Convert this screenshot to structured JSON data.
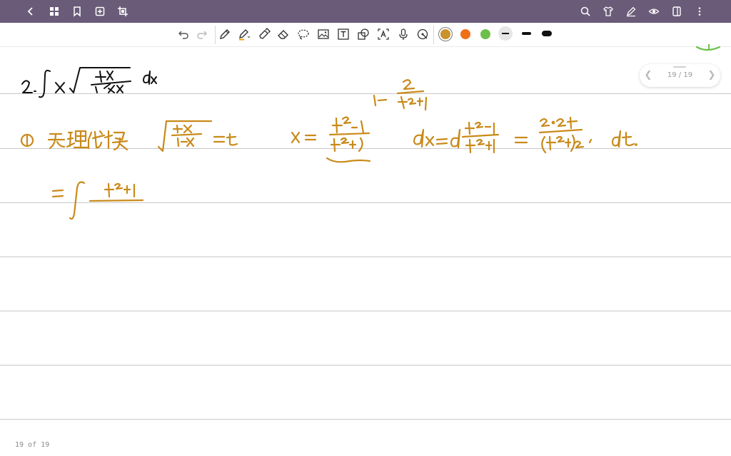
{
  "colors": {
    "topbar": "#6a5b78",
    "ink_black": "#111111",
    "ink_orange": "#c98a1a",
    "swatch_gold": "#c9922a",
    "swatch_orange": "#f07018",
    "swatch_green": "#6cc04a",
    "rule_line": "#c8c8c8"
  },
  "topbar": {
    "left_icons": [
      "back-chevron-icon",
      "grid-icon",
      "bookmark-icon",
      "add-page-icon",
      "crop-icon"
    ],
    "right_icons": [
      "search-icon",
      "shirt-icon",
      "pen-edit-icon",
      "eye-icon",
      "page-view-icon",
      "more-vertical-icon"
    ]
  },
  "toolbar": {
    "tools": [
      "undo-icon",
      "redo-icon",
      "pen-icon",
      "highlighter-icon",
      "marker-icon",
      "eraser-icon",
      "lasso-icon",
      "image-icon",
      "text-box-icon",
      "shapes-icon",
      "text-recognition-icon",
      "microphone-icon",
      "pointer-icon"
    ],
    "swatches": [
      "gold",
      "orange",
      "green"
    ],
    "strokes": [
      "thin",
      "medium",
      "thick"
    ]
  },
  "page_indicator": {
    "count": "19 / 19"
  },
  "footer": {
    "text": "19 of 19"
  }
}
